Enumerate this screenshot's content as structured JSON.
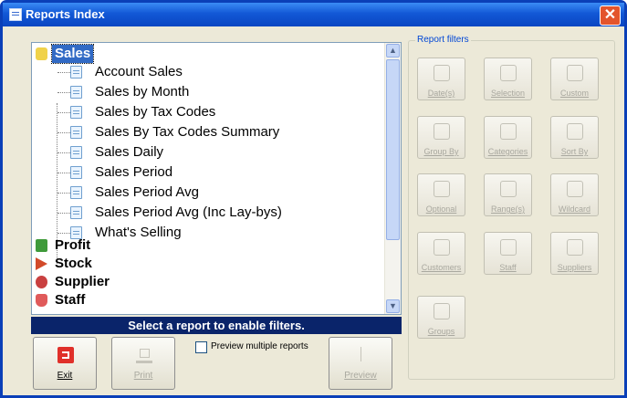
{
  "window": {
    "title": "Reports Index",
    "close_glyph": "✕"
  },
  "tree": {
    "categories": [
      {
        "label": "Sales",
        "icon": "sales-folder-icon",
        "selected": true,
        "expanded": true,
        "children": [
          "Account Sales",
          "Sales by Month",
          "Sales by Tax Codes",
          "Sales By Tax Codes Summary",
          "Sales Daily",
          "Sales Period",
          "Sales Period Avg",
          "Sales Period Avg (Inc Lay-bys)",
          "What's Selling"
        ]
      },
      {
        "label": "Profit",
        "icon": "profit-icon"
      },
      {
        "label": "Stock",
        "icon": "stock-icon"
      },
      {
        "label": "Supplier",
        "icon": "supplier-icon"
      },
      {
        "label": "Staff",
        "icon": "staff-icon"
      }
    ],
    "scroll_up": "▲",
    "scroll_down": "▼"
  },
  "status_text": "Select a report to enable filters.",
  "buttons": {
    "exit": "Exit",
    "print": "Print",
    "preview": "Preview"
  },
  "preview_multiple_label": "Preview multiple reports",
  "preview_multiple_checked": false,
  "filters": {
    "title": "Report filters",
    "items": [
      "Date(s)",
      "Selection",
      "Custom",
      "Group By",
      "Categories",
      "Sort By",
      "Optional",
      "Range(s)",
      "Wildcard",
      "Customers",
      "Staff",
      "Suppliers",
      "Groups"
    ]
  },
  "colors": {
    "title_bar": "#1258d6",
    "status_bar": "#0a246a",
    "selection": "#316ac5",
    "window_bg": "#ece9d8"
  }
}
